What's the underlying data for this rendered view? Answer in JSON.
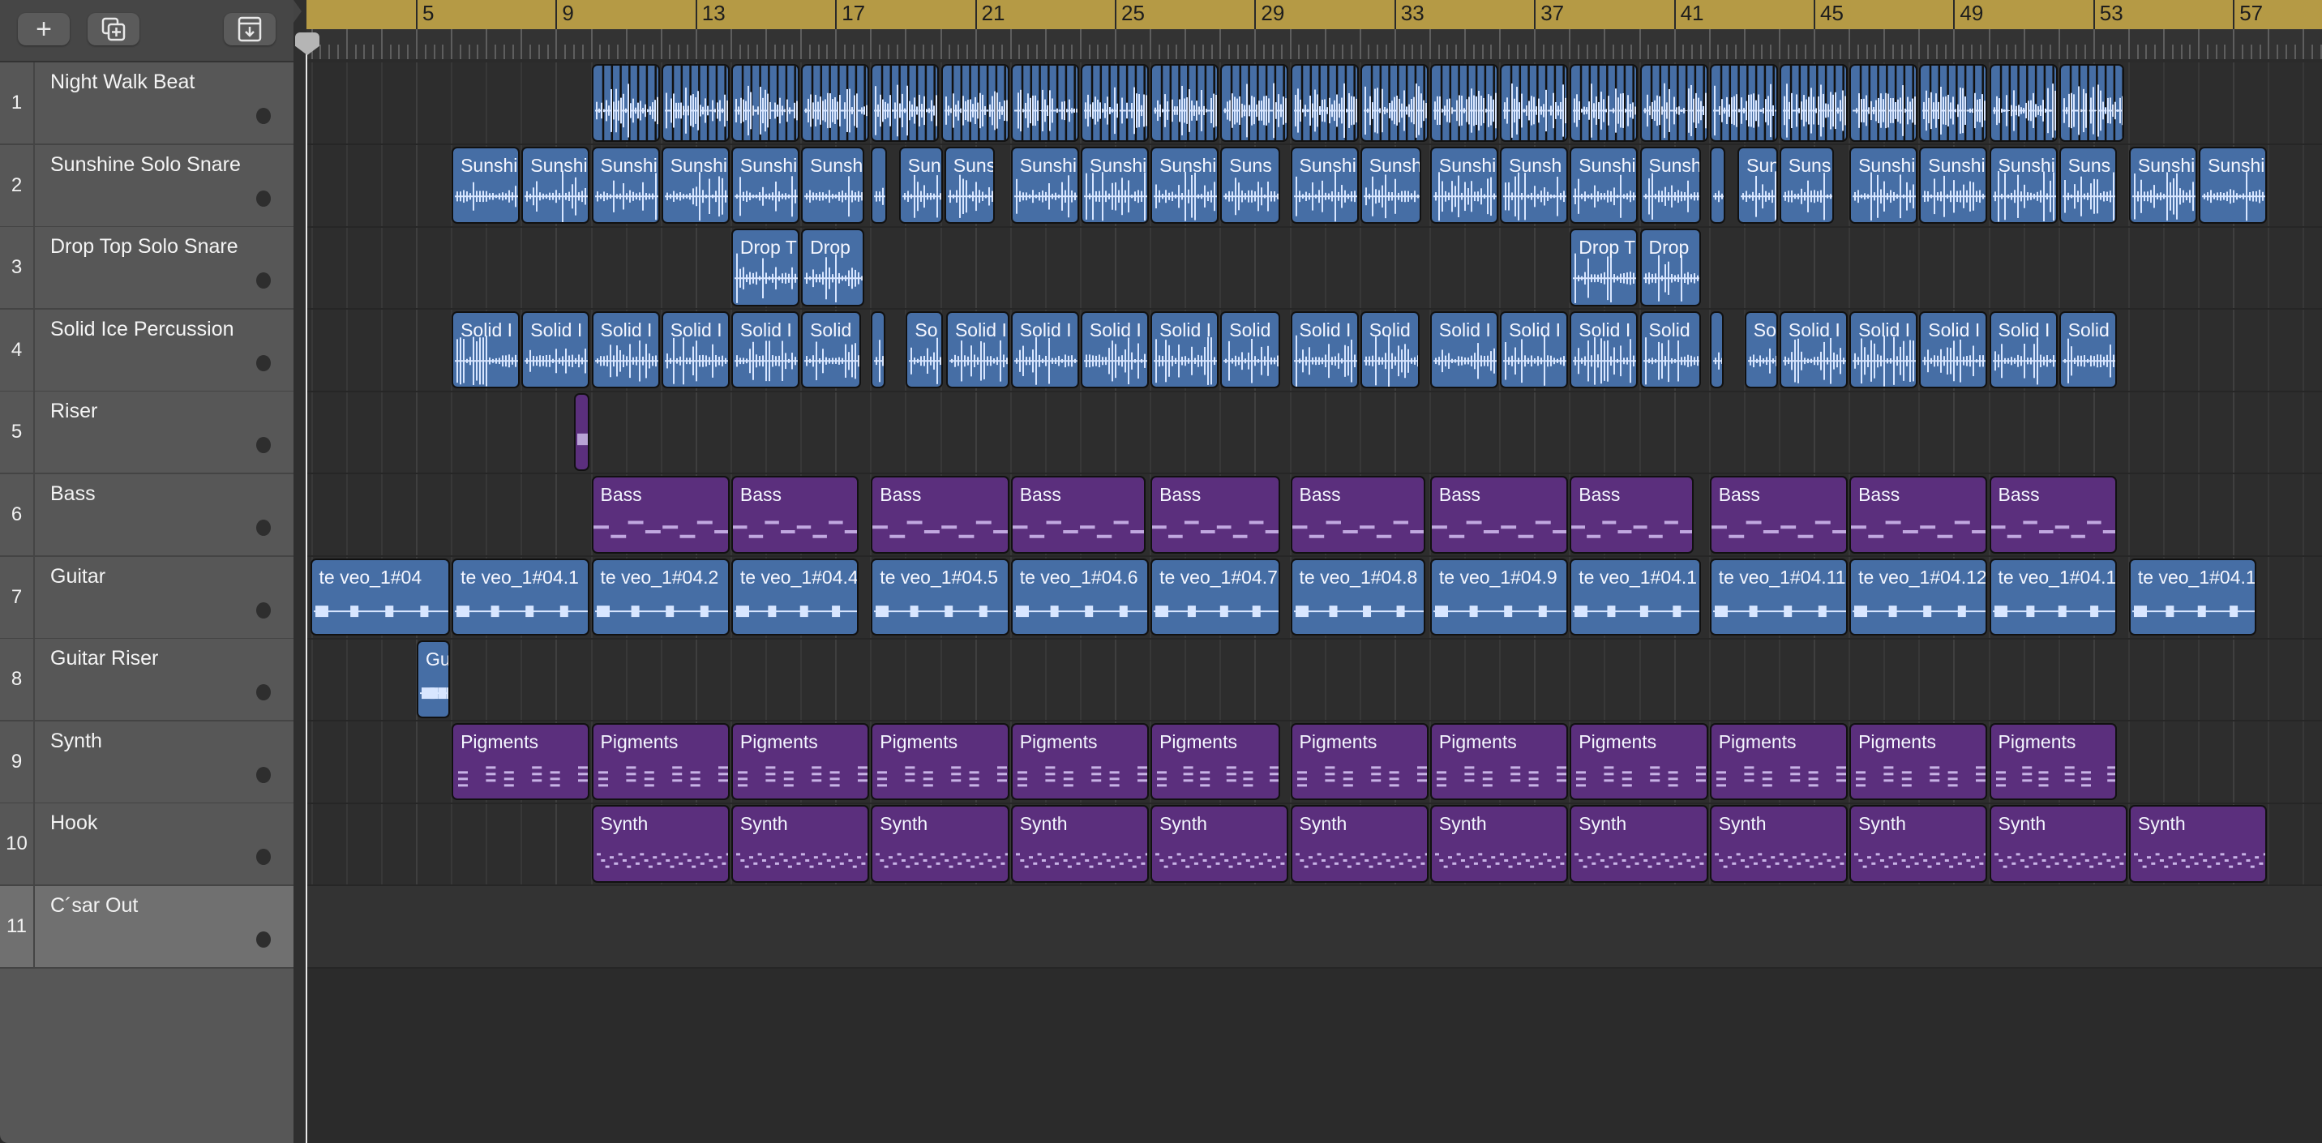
{
  "toolbar": {
    "buttons": [
      {
        "name": "add-track-button",
        "icon": "plus-icon",
        "glyph": "+"
      },
      {
        "name": "duplicate-track-button",
        "icon": "duplicate-plus-icon"
      },
      {
        "name": "import-button",
        "icon": "download-tray-icon"
      }
    ]
  },
  "ruler": {
    "bar_labels": [
      "5",
      "9",
      "13",
      "17",
      "21",
      "25",
      "29",
      "33",
      "37",
      "41",
      "45",
      "49",
      "53",
      "57"
    ]
  },
  "colors": {
    "audio": "#466ea5",
    "midi": "#5b2f7d",
    "ruler": "#b59a45"
  },
  "tracks": [
    {
      "number": "1",
      "name": "Night Walk Beat",
      "kind": "audio",
      "sliced": true,
      "regions": [
        [
          10,
          12,
          ""
        ],
        [
          12,
          14,
          ""
        ],
        [
          14,
          16,
          ""
        ],
        [
          16,
          18,
          ""
        ],
        [
          18,
          20,
          ""
        ],
        [
          20,
          22,
          ""
        ],
        [
          22,
          24,
          ""
        ],
        [
          24,
          26,
          ""
        ],
        [
          26,
          28,
          ""
        ],
        [
          28,
          30,
          ""
        ],
        [
          30,
          32,
          ""
        ],
        [
          32,
          34,
          ""
        ],
        [
          34,
          36,
          ""
        ],
        [
          36,
          38,
          ""
        ],
        [
          38,
          40,
          ""
        ],
        [
          40,
          42,
          ""
        ],
        [
          42,
          44,
          ""
        ],
        [
          44,
          46,
          ""
        ],
        [
          46,
          48,
          ""
        ],
        [
          48,
          50,
          ""
        ],
        [
          50,
          52,
          ""
        ],
        [
          52,
          53.9,
          ""
        ]
      ]
    },
    {
      "number": "2",
      "name": "Sunshine Solo Snare",
      "kind": "audio",
      "regions": [
        [
          6,
          8,
          "Sunshi"
        ],
        [
          8,
          10,
          "Sunshi"
        ],
        [
          10,
          12,
          "Sunshi"
        ],
        [
          12,
          14,
          "Sunshi"
        ],
        [
          14,
          16,
          "Sunshi"
        ],
        [
          16,
          17.85,
          "Sunsh"
        ],
        [
          18,
          18.5,
          ""
        ],
        [
          18.8,
          20.1,
          "Sun"
        ],
        [
          20.1,
          21.6,
          "Suns"
        ],
        [
          22,
          24,
          "Sunshi"
        ],
        [
          24,
          26,
          "Sunshi"
        ],
        [
          26,
          28,
          "Sunshi"
        ],
        [
          28,
          29.75,
          "Suns"
        ],
        [
          30,
          32,
          "Sunshi"
        ],
        [
          32,
          33.8,
          "Sunsh"
        ],
        [
          34,
          36,
          "Sunshi"
        ],
        [
          36,
          38,
          "Sunsh"
        ],
        [
          38,
          40,
          "Sunshi"
        ],
        [
          40,
          41.8,
          "Sunsh"
        ],
        [
          42,
          42.5,
          ""
        ],
        [
          42.8,
          44,
          "Sun"
        ],
        [
          44,
          45.6,
          "Suns"
        ],
        [
          46,
          48,
          "Sunshi"
        ],
        [
          48,
          50,
          "Sunshi"
        ],
        [
          50,
          52,
          "Sunshi"
        ],
        [
          52,
          53.7,
          "Suns"
        ],
        [
          54,
          56,
          "Sunshi"
        ],
        [
          56,
          58,
          "Sunshi"
        ]
      ]
    },
    {
      "number": "3",
      "name": "Drop Top Solo Snare",
      "kind": "audio",
      "regions": [
        [
          14,
          16,
          "Drop T"
        ],
        [
          16,
          17.85,
          "Drop"
        ],
        [
          38,
          40,
          "Drop T"
        ],
        [
          40,
          41.8,
          "Drop"
        ]
      ]
    },
    {
      "number": "4",
      "name": "Solid Ice Percussion",
      "kind": "audio",
      "regions": [
        [
          6,
          8,
          "Solid I"
        ],
        [
          8,
          10,
          "Solid I"
        ],
        [
          10,
          12,
          "Solid I"
        ],
        [
          12,
          14,
          "Solid I"
        ],
        [
          14,
          16,
          "Solid I"
        ],
        [
          16,
          17.75,
          "Solid"
        ],
        [
          18,
          18.45,
          ""
        ],
        [
          19,
          20.1,
          "So"
        ],
        [
          20.15,
          22,
          "Solid I"
        ],
        [
          22,
          24,
          "Solid I"
        ],
        [
          24,
          26,
          "Solid I"
        ],
        [
          26,
          28,
          "Solid I"
        ],
        [
          28,
          29.75,
          "Solid"
        ],
        [
          30,
          32,
          "Solid I"
        ],
        [
          32,
          33.75,
          "Solid"
        ],
        [
          34,
          36,
          "Solid I"
        ],
        [
          36,
          38,
          "Solid I"
        ],
        [
          38,
          40,
          "Solid I"
        ],
        [
          40,
          41.8,
          "Solid"
        ],
        [
          42,
          42.45,
          ""
        ],
        [
          43,
          44,
          "So"
        ],
        [
          44,
          46,
          "Solid I"
        ],
        [
          46,
          48,
          "Solid I"
        ],
        [
          48,
          50,
          "Solid I"
        ],
        [
          50,
          52,
          "Solid I"
        ],
        [
          52,
          53.7,
          "Solid"
        ]
      ]
    },
    {
      "number": "5",
      "name": "Riser",
      "kind": "midi",
      "regions": [
        [
          9.5,
          10,
          ""
        ]
      ]
    },
    {
      "number": "6",
      "name": "Bass",
      "kind": "midi",
      "regions": [
        [
          10,
          14,
          "Bass"
        ],
        [
          14,
          17.7,
          "Bass"
        ],
        [
          18,
          22,
          "Bass"
        ],
        [
          22,
          25.9,
          "Bass"
        ],
        [
          26,
          29.75,
          "Bass"
        ],
        [
          30,
          33.9,
          "Bass"
        ],
        [
          34,
          38,
          "Bass"
        ],
        [
          38,
          41.6,
          "Bass"
        ],
        [
          42,
          46,
          "Bass"
        ],
        [
          46,
          50,
          "Bass"
        ],
        [
          50,
          53.7,
          "Bass"
        ]
      ]
    },
    {
      "number": "7",
      "name": "Guitar",
      "kind": "audio",
      "regions": [
        [
          1.95,
          6,
          "te veo_1#04"
        ],
        [
          6,
          10,
          "te veo_1#04.1"
        ],
        [
          10,
          14,
          "te veo_1#04.2"
        ],
        [
          14,
          17.7,
          "te veo_1#04.4"
        ],
        [
          18,
          22,
          "te veo_1#04.5"
        ],
        [
          22,
          26,
          "te veo_1#04.6"
        ],
        [
          26,
          29.75,
          "te veo_1#04.7"
        ],
        [
          30,
          33.9,
          "te veo_1#04.8"
        ],
        [
          34,
          38,
          "te veo_1#04.9"
        ],
        [
          38,
          41.8,
          "te veo_1#04.1"
        ],
        [
          42,
          46,
          "te veo_1#04.11"
        ],
        [
          46,
          50,
          "te veo_1#04.12"
        ],
        [
          50,
          53.7,
          "te veo_1#04.1"
        ],
        [
          54,
          57.7,
          "te veo_1#04.1"
        ]
      ]
    },
    {
      "number": "8",
      "name": "Guitar Riser",
      "kind": "audio",
      "regions": [
        [
          5,
          6,
          "Gu"
        ]
      ]
    },
    {
      "number": "9",
      "name": "Synth",
      "kind": "midi",
      "regions": [
        [
          6,
          10,
          "Pigments"
        ],
        [
          10,
          14,
          "Pigments"
        ],
        [
          14,
          18,
          "Pigments"
        ],
        [
          18,
          22,
          "Pigments"
        ],
        [
          22,
          26,
          "Pigments"
        ],
        [
          26,
          29.75,
          "Pigments"
        ],
        [
          30,
          34,
          "Pigments"
        ],
        [
          34,
          38,
          "Pigments"
        ],
        [
          38,
          42,
          "Pigments"
        ],
        [
          42,
          46,
          "Pigments"
        ],
        [
          46,
          50,
          "Pigments"
        ],
        [
          50,
          53.7,
          "Pigments"
        ]
      ]
    },
    {
      "number": "10",
      "name": "Hook",
      "kind": "midi",
      "regions": [
        [
          10,
          14,
          "Synth"
        ],
        [
          14,
          18,
          "Synth"
        ],
        [
          18,
          22,
          "Synth"
        ],
        [
          22,
          26,
          "Synth"
        ],
        [
          26,
          30,
          "Synth"
        ],
        [
          30,
          34,
          "Synth"
        ],
        [
          34,
          38,
          "Synth"
        ],
        [
          38,
          42,
          "Synth"
        ],
        [
          42,
          46,
          "Synth"
        ],
        [
          46,
          50,
          "Synth"
        ],
        [
          50,
          54,
          "Synth"
        ],
        [
          54,
          58,
          "Synth"
        ]
      ]
    },
    {
      "number": "11",
      "name": "C´sar Out",
      "kind": "audio",
      "selected": true,
      "regions": []
    }
  ]
}
